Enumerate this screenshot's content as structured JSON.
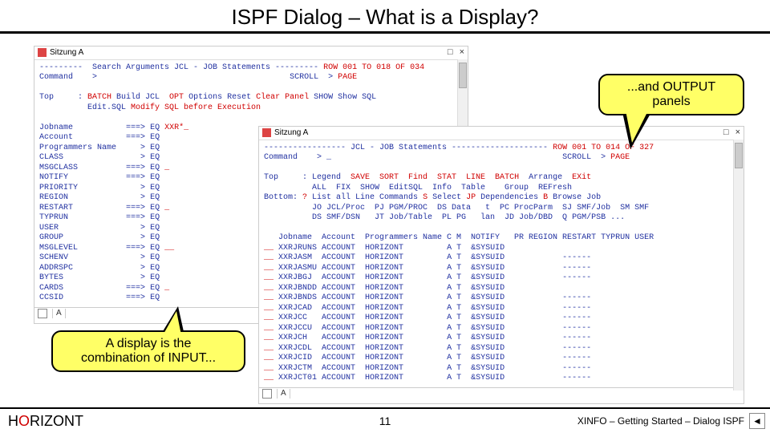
{
  "slide_title": "ISPF Dialog – What is a Display?",
  "callout_output": "...and OUTPUT\npanels",
  "callout_input": "A display is the\ncombination of INPUT...",
  "footer": {
    "brand": "HORIZONT",
    "page": "11",
    "right": "XINFO – Getting Started – Dialog ISPF"
  },
  "term1": {
    "title": "Sitzung A",
    "l1a": "---------  Search Arguments JCL - JOB Statements ---------",
    "l1b": " ROW 001 TO 018 OF 034",
    "l2a": "Command    >",
    "l2b": "SCROLL  > ",
    "l2c": "PAGE",
    "l4": "Top     : ",
    "l4b": "BATCH",
    "l4c": " Build JCL  ",
    "l4d": "OPT",
    "l4e": " Options Reset ",
    "l4f": "Clear Panel ",
    "l4g": "SHOW",
    "l4h": " Show SQL",
    "l5": "          Edit.SQL ",
    "l5b": "Modify SQL before Execution",
    "rows": [
      {
        "n": "Jobname",
        "m": "===>",
        "o": "EQ",
        "v": "XXR*_"
      },
      {
        "n": "Account",
        "m": "===>",
        "o": "EQ",
        "v": ""
      },
      {
        "n": "Programmers Name",
        "m": "   >",
        "o": "EQ",
        "v": ""
      },
      {
        "n": "CLASS",
        "m": "   >",
        "o": "EQ",
        "v": ""
      },
      {
        "n": "MSGCLASS",
        "m": "===>",
        "o": "EQ",
        "v": "_"
      },
      {
        "n": "NOTIFY",
        "m": "===>",
        "o": "EQ",
        "v": ""
      },
      {
        "n": "PRIORITY",
        "m": "   >",
        "o": "EQ",
        "v": ""
      },
      {
        "n": "REGION",
        "m": "   >",
        "o": "EQ",
        "v": ""
      },
      {
        "n": "RESTART",
        "m": "===>",
        "o": "EQ",
        "v": "_"
      },
      {
        "n": "TYPRUN",
        "m": "===>",
        "o": "EQ",
        "v": ""
      },
      {
        "n": "USER",
        "m": "   >",
        "o": "EQ",
        "v": ""
      },
      {
        "n": "GROUP",
        "m": "   >",
        "o": "EQ",
        "v": ""
      },
      {
        "n": "MSGLEVEL",
        "m": "===>",
        "o": "EQ",
        "v": "__"
      },
      {
        "n": "SCHENV",
        "m": "   >",
        "o": "EQ",
        "v": ""
      },
      {
        "n": "ADDRSPC",
        "m": "   >",
        "o": "EQ",
        "v": ""
      },
      {
        "n": "BYTES",
        "m": "   >",
        "o": "EQ",
        "v": ""
      },
      {
        "n": "CARDS",
        "m": "===>",
        "o": "EQ",
        "v": "_"
      },
      {
        "n": "CCSID",
        "m": "===>",
        "o": "EQ",
        "v": ""
      }
    ],
    "status": "A"
  },
  "term2": {
    "title": "Sitzung A",
    "l1a": "----------------- JCL - JOB Statements --------------------",
    "l1b": " ROW 001 TO 014 OF 327",
    "l2a": "Command    > _",
    "l2b": "SCROLL  > ",
    "l2c": "PAGE",
    "l4": "Top     : Legend  ",
    "l4b": "SAVE  SORT  Find  STAT  LINE  BATCH  ",
    "l4c": "Arrange  ",
    "l4d": "EXit",
    "l5": "          ALL  FIX  SHOW  EditSQL  Info  Table    Group  REFresh",
    "l6": "Bottom: ",
    "l6b": "?",
    "l6c": " List all Line Commands ",
    "l6d": "S",
    "l6e": " Select ",
    "l6f": "JP",
    "l6g": " Dependencies ",
    "l6h": "B",
    "l6i": " Browse Job",
    "l7": "          JO JCL/Proc  PJ PGM/PROC  DS Data   t  PC ProcParm  SJ SMF/Job  SM SMF",
    "l8": "          DS SMF/DSN   JT Job/Table  PL PG   lan  JD Job/DBD  Q PGM/PSB ...",
    "hdr": "   Jobname  Account  Programmers Name C M  NOTIFY   PR REGION RESTART TYPRUN USER",
    "rows": [
      {
        "j": "XXRJRUNS",
        "a": "ACCOUNT",
        "p": "HORIZONT",
        "c": "A",
        "m": "T",
        "n": "&SYSUID",
        "r": "",
        "s": ""
      },
      {
        "j": "XXRJASM ",
        "a": "ACCOUNT",
        "p": "HORIZONT",
        "c": "A",
        "m": "T",
        "n": "&SYSUID",
        "r": "",
        "s": "------"
      },
      {
        "j": "XXRJASMU",
        "a": "ACCOUNT",
        "p": "HORIZONT",
        "c": "A",
        "m": "T",
        "n": "&SYSUID",
        "r": "",
        "s": "------"
      },
      {
        "j": "XXRJBGJ ",
        "a": "ACCOUNT",
        "p": "HORIZONT",
        "c": "A",
        "m": "T",
        "n": "&SYSUID",
        "r": "",
        "s": "------"
      },
      {
        "j": "XXRJBNDD",
        "a": "ACCOUNT",
        "p": "HORIZONT",
        "c": "A",
        "m": "T",
        "n": "&SYSUID",
        "r": "",
        "s": ""
      },
      {
        "j": "XXRJBNDS",
        "a": "ACCOUNT",
        "p": "HORIZONT",
        "c": "A",
        "m": "T",
        "n": "&SYSUID",
        "r": "",
        "s": "------"
      },
      {
        "j": "XXRJCAD ",
        "a": "ACCOUNT",
        "p": "HORIZONT",
        "c": "A",
        "m": "T",
        "n": "&SYSUID",
        "r": "",
        "s": "------"
      },
      {
        "j": "XXRJCC  ",
        "a": "ACCOUNT",
        "p": "HORIZONT",
        "c": "A",
        "m": "T",
        "n": "&SYSUID",
        "r": "",
        "s": "------"
      },
      {
        "j": "XXRJCCU ",
        "a": "ACCOUNT",
        "p": "HORIZONT",
        "c": "A",
        "m": "T",
        "n": "&SYSUID",
        "r": "",
        "s": "------"
      },
      {
        "j": "XXRJCH  ",
        "a": "ACCOUNT",
        "p": "HORIZONT",
        "c": "A",
        "m": "T",
        "n": "&SYSUID",
        "r": "",
        "s": "------"
      },
      {
        "j": "XXRJCDL ",
        "a": "ACCOUNT",
        "p": "HORIZONT",
        "c": "A",
        "m": "T",
        "n": "&SYSUID",
        "r": "",
        "s": "------"
      },
      {
        "j": "XXRJCID ",
        "a": "ACCOUNT",
        "p": "HORIZONT",
        "c": "A",
        "m": "T",
        "n": "&SYSUID",
        "r": "",
        "s": "------"
      },
      {
        "j": "XXRJCTM ",
        "a": "ACCOUNT",
        "p": "HORIZONT",
        "c": "A",
        "m": "T",
        "n": "&SYSUID",
        "r": "",
        "s": "------"
      },
      {
        "j": "XXRJCT01",
        "a": "ACCOUNT",
        "p": "HORIZONT",
        "c": "A",
        "m": "T",
        "n": "&SYSUID",
        "r": "",
        "s": "------"
      }
    ],
    "status": "A"
  }
}
